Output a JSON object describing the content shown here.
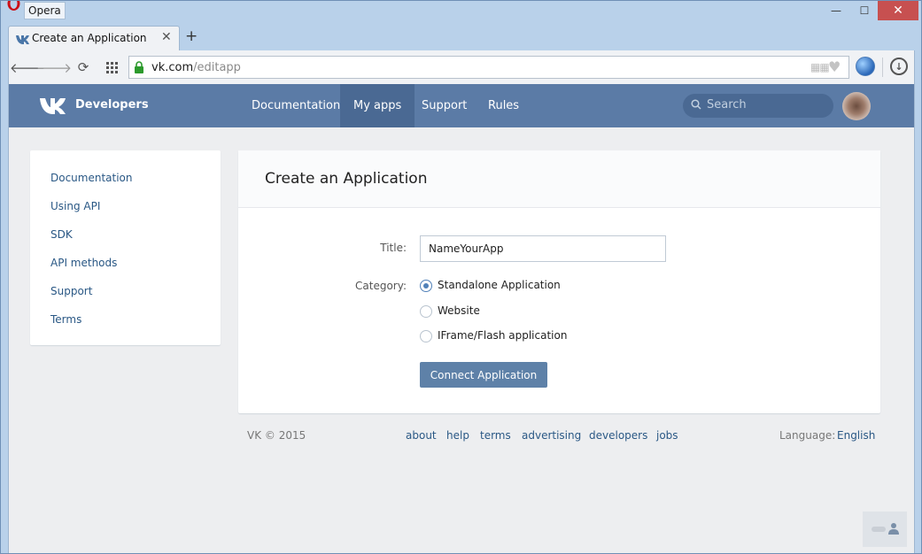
{
  "browser": {
    "app_name": "Opera",
    "tab_title": "Create an Application",
    "tab_close": "✕",
    "new_tab": "+",
    "url_host": "vk.com",
    "url_path": "/editapp",
    "window_buttons": {
      "minimize": "—",
      "maximize": "☐",
      "close": "✕"
    }
  },
  "header": {
    "brand": "Developers",
    "nav": [
      {
        "label": "Documentation",
        "active": false
      },
      {
        "label": "My apps",
        "active": true
      },
      {
        "label": "Support",
        "active": false
      },
      {
        "label": "Rules",
        "active": false
      }
    ],
    "search_placeholder": "Search"
  },
  "sidebar": {
    "items": [
      {
        "label": "Documentation"
      },
      {
        "label": "Using API"
      },
      {
        "label": "SDK"
      },
      {
        "label": "API methods"
      },
      {
        "label": "Support"
      },
      {
        "label": "Terms"
      }
    ]
  },
  "main": {
    "title": "Create an Application",
    "title_label": "Title:",
    "title_value": "NameYourApp",
    "category_label": "Category:",
    "categories": [
      {
        "label": "Standalone Application",
        "selected": true
      },
      {
        "label": "Website",
        "selected": false
      },
      {
        "label": "IFrame/Flash application",
        "selected": false
      }
    ],
    "submit_label": "Connect Application"
  },
  "footer": {
    "copyright": "VK © 2015",
    "links": [
      "about",
      "help",
      "terms",
      "advertising",
      "developers",
      "jobs"
    ],
    "language_label": "Language:",
    "language_value": "English"
  },
  "colors": {
    "header_bg": "#5b7ba6",
    "active_nav_bg": "#4a6993",
    "link": "#2a5885",
    "button_bg": "#5e81a8",
    "page_bg": "#edeef0"
  }
}
